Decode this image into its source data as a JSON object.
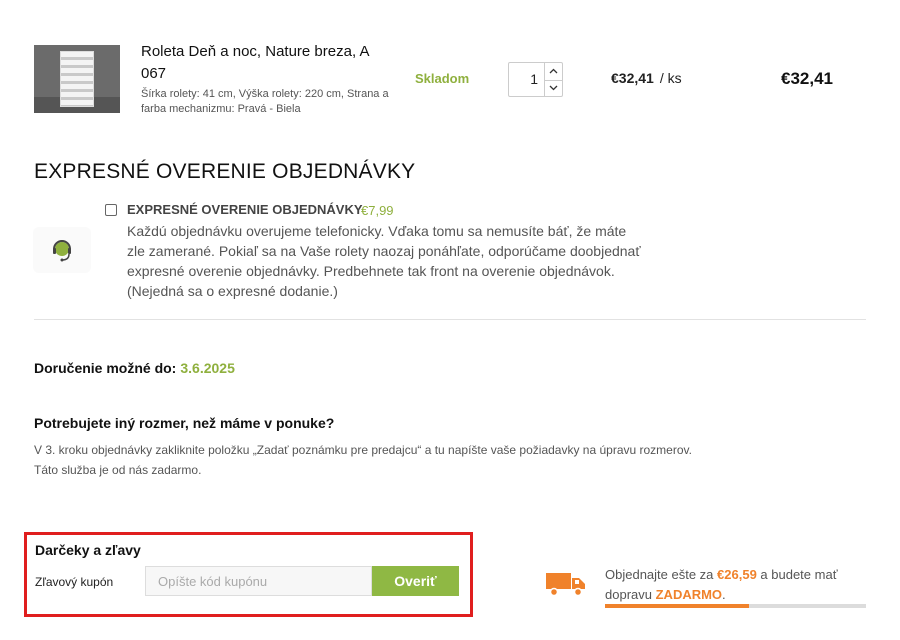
{
  "product": {
    "name": "Roleta Deň a noc, Nature breza, A 067",
    "specs": "Šírka rolety: 41 cm, Výška rolety: 220 cm, Strana a farba mechanizmu: Pravá - Biela",
    "stock": "Skladom",
    "quantity": "1",
    "unit_price": "€32,41",
    "unit": "/ ks",
    "total": "€32,41",
    "thumbnail_icon": "product-photo"
  },
  "express": {
    "title": "EXPRESNÉ OVERENIE OBJEDNÁVKY",
    "option_label": "EXPRESNÉ OVERENIE OBJEDNÁVKY",
    "option_price": "€7,99",
    "checked": false,
    "description": "Každú objednávku overujeme telefonicky. Vďaka tomu sa nemusíte báť, že máte zle zamerané. Pokiaľ sa na Vaše rolety naozaj ponáhľate, odporúčame doobjednať expresné overenie objednávky. Predbehnete tak front na overenie objednávok. (Nejedná sa o expresné dodanie.)",
    "icon": "headset-icon"
  },
  "delivery": {
    "label": "Doručenie možné do:",
    "date": "3.6.2025"
  },
  "custom_size": {
    "title": "Potrebujete iný rozmer, než máme v ponuke?",
    "line1": "V 3. kroku objednávky zakliknite položku „Zadať poznámku pre predajcu“ a tu napíšte vaše požiadavky na úpravu rozmerov.",
    "line2": "Táto služba je od nás zadarmo."
  },
  "coupon": {
    "title": "Darčeky a zľavy",
    "label": "Zľavový kupón",
    "placeholder": "Opíšte kód kupónu",
    "value": "",
    "button": "Overiť"
  },
  "free_shipping": {
    "prefix": "Objednajte ešte za",
    "amount": "€26,59",
    "middle": "a budete mať dopravu",
    "free": "ZADARMO",
    "suffix": ".",
    "progress_fraction": 0.55,
    "icon": "truck-icon"
  },
  "colors": {
    "green": "#8fb03e",
    "orange": "#f0822b",
    "highlight_red": "#e01e1e"
  }
}
